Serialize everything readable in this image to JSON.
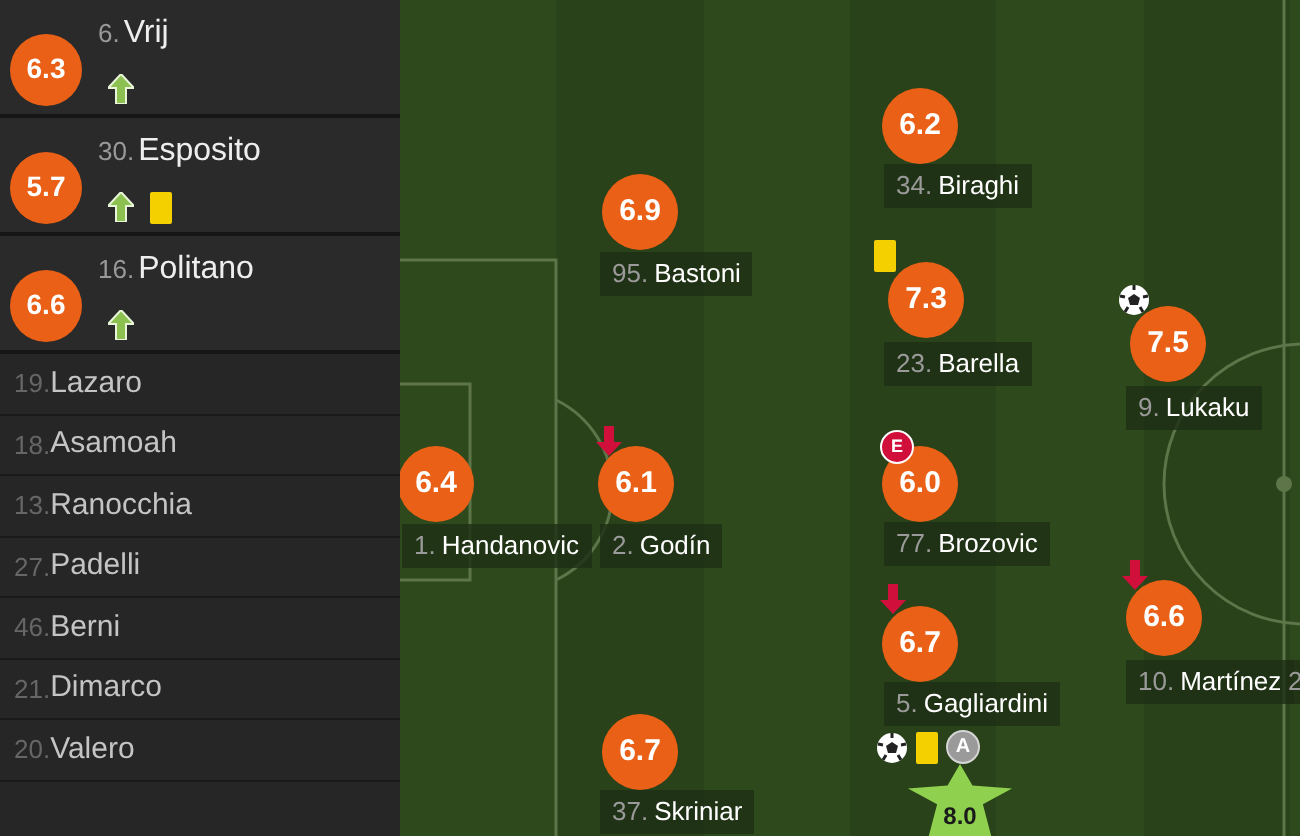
{
  "sidebar": {
    "subbed_in": [
      {
        "number": "6.",
        "name": "Vrij",
        "rating": "6.3",
        "events": [
          {
            "kind": "sub_in"
          }
        ]
      },
      {
        "number": "30.",
        "name": "Esposito",
        "rating": "5.7",
        "events": [
          {
            "kind": "sub_in"
          },
          {
            "kind": "yellow_card"
          }
        ]
      },
      {
        "number": "16.",
        "name": "Politano",
        "rating": "6.6",
        "events": [
          {
            "kind": "sub_in"
          }
        ]
      }
    ],
    "bench": [
      {
        "number": "19.",
        "name": "Lazaro"
      },
      {
        "number": "18.",
        "name": "Asamoah"
      },
      {
        "number": "13.",
        "name": "Ranocchia"
      },
      {
        "number": "27.",
        "name": "Padelli"
      },
      {
        "number": "46.",
        "name": "Berni"
      },
      {
        "number": "21.",
        "name": "Dimarco"
      },
      {
        "number": "20.",
        "name": "Valero"
      }
    ]
  },
  "pitch": {
    "players": [
      {
        "kind": "rated",
        "number": "34.",
        "name": "Biraghi",
        "rating": "6.2"
      },
      {
        "kind": "rated",
        "number": "95.",
        "name": "Bastoni",
        "rating": "6.9"
      },
      {
        "kind": "rated",
        "number": "23.",
        "name": "Barella",
        "rating": "7.3",
        "events": [
          {
            "kind": "yellow_card"
          }
        ]
      },
      {
        "kind": "rated",
        "number": "9.",
        "name": "Lukaku",
        "rating": "7.5",
        "events": [
          {
            "kind": "goal"
          }
        ]
      },
      {
        "kind": "rated",
        "number": "1.",
        "name": "Handanovic",
        "rating": "6.4"
      },
      {
        "kind": "rated",
        "number": "2.",
        "name": "Godín",
        "rating": "6.1",
        "events": [
          {
            "kind": "sub_out"
          }
        ]
      },
      {
        "kind": "rated",
        "number": "77.",
        "name": "Brozovic",
        "rating": "6.0",
        "events": [
          {
            "kind": "badge",
            "label": "E"
          }
        ]
      },
      {
        "kind": "rated",
        "number": "10.",
        "name": "Martínez",
        "rating": "6.6",
        "events": [
          {
            "kind": "sub_out"
          }
        ]
      },
      {
        "kind": "rated",
        "number": "5.",
        "name": "Gagliardini",
        "rating": "6.7",
        "events": [
          {
            "kind": "sub_out"
          }
        ]
      },
      {
        "kind": "label_only",
        "number": "2"
      },
      {
        "kind": "rated",
        "number": "37.",
        "name": "Skriniar",
        "rating": "6.7"
      },
      {
        "kind": "top_rated",
        "rating": "8.0",
        "events": [
          {
            "kind": "goal"
          },
          {
            "kind": "yellow_card"
          },
          {
            "kind": "assist",
            "label": "A"
          }
        ]
      }
    ]
  }
}
